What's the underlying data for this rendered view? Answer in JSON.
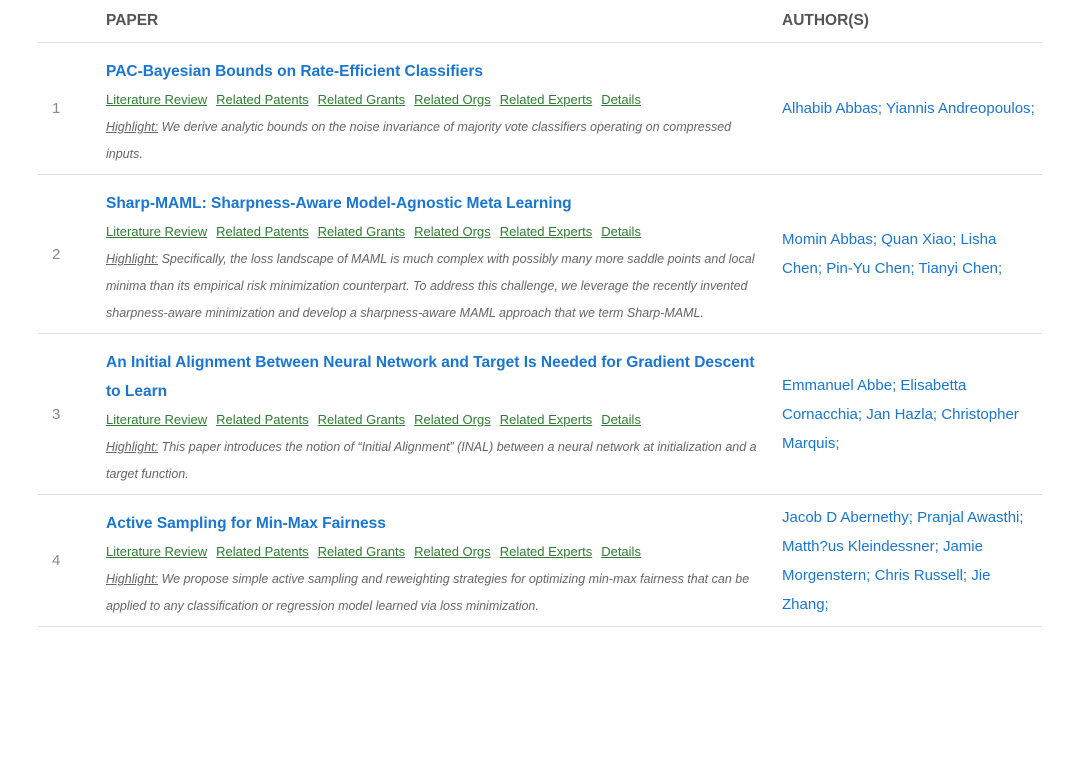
{
  "header": {
    "paper": "PAPER",
    "authors": "AUTHOR(S)"
  },
  "link_labels": [
    "Literature Review",
    "Related Patents",
    "Related Grants",
    "Related Orgs",
    "Related Experts",
    "Details"
  ],
  "highlight_label": "Highlight:",
  "papers": [
    {
      "num": "1",
      "title": "PAC-Bayesian Bounds on Rate-Efficient Classifiers",
      "highlight": " We derive analytic bounds on the noise invariance of majority vote classifiers operating on compressed inputs.",
      "authors": [
        "Alhabib Abbas",
        "Yiannis Andreopoulos"
      ]
    },
    {
      "num": "2",
      "title": "Sharp-MAML: Sharpness-Aware Model-Agnostic Meta Learning",
      "highlight": " Specifically, the loss landscape of MAML is much complex with possibly many more saddle points and local minima than its empirical risk minimization counterpart. To address this challenge, we leverage the recently invented sharpness-aware minimization and develop a sharpness-aware MAML approach that we term Sharp-MAML.",
      "authors": [
        "Momin Abbas",
        "Quan Xiao",
        "Lisha Chen",
        "Pin-Yu Chen",
        "Tianyi Chen"
      ]
    },
    {
      "num": "3",
      "title": "An Initial Alignment Between Neural Network and Target Is Needed for Gradient Descent to Learn",
      "highlight": " This paper introduces the notion of “Initial Alignment” (INAL) between a neural network at initialization and a target function.",
      "authors": [
        "Emmanuel Abbe",
        "Elisabetta Cornacchia",
        "Jan Hazla",
        "Christopher Marquis"
      ]
    },
    {
      "num": "4",
      "title": "Active Sampling for Min-Max Fairness",
      "highlight": " We propose simple active sampling and reweighting strategies for optimizing min-max fairness that can be applied to any classification or regression model learned via loss minimization.",
      "authors": [
        "Jacob D Abernethy",
        "Pranjal Awasthi",
        "Matth?us Kleindessner",
        "Jamie Morgenstern",
        "Chris Russell",
        "Jie Zhang"
      ]
    }
  ]
}
